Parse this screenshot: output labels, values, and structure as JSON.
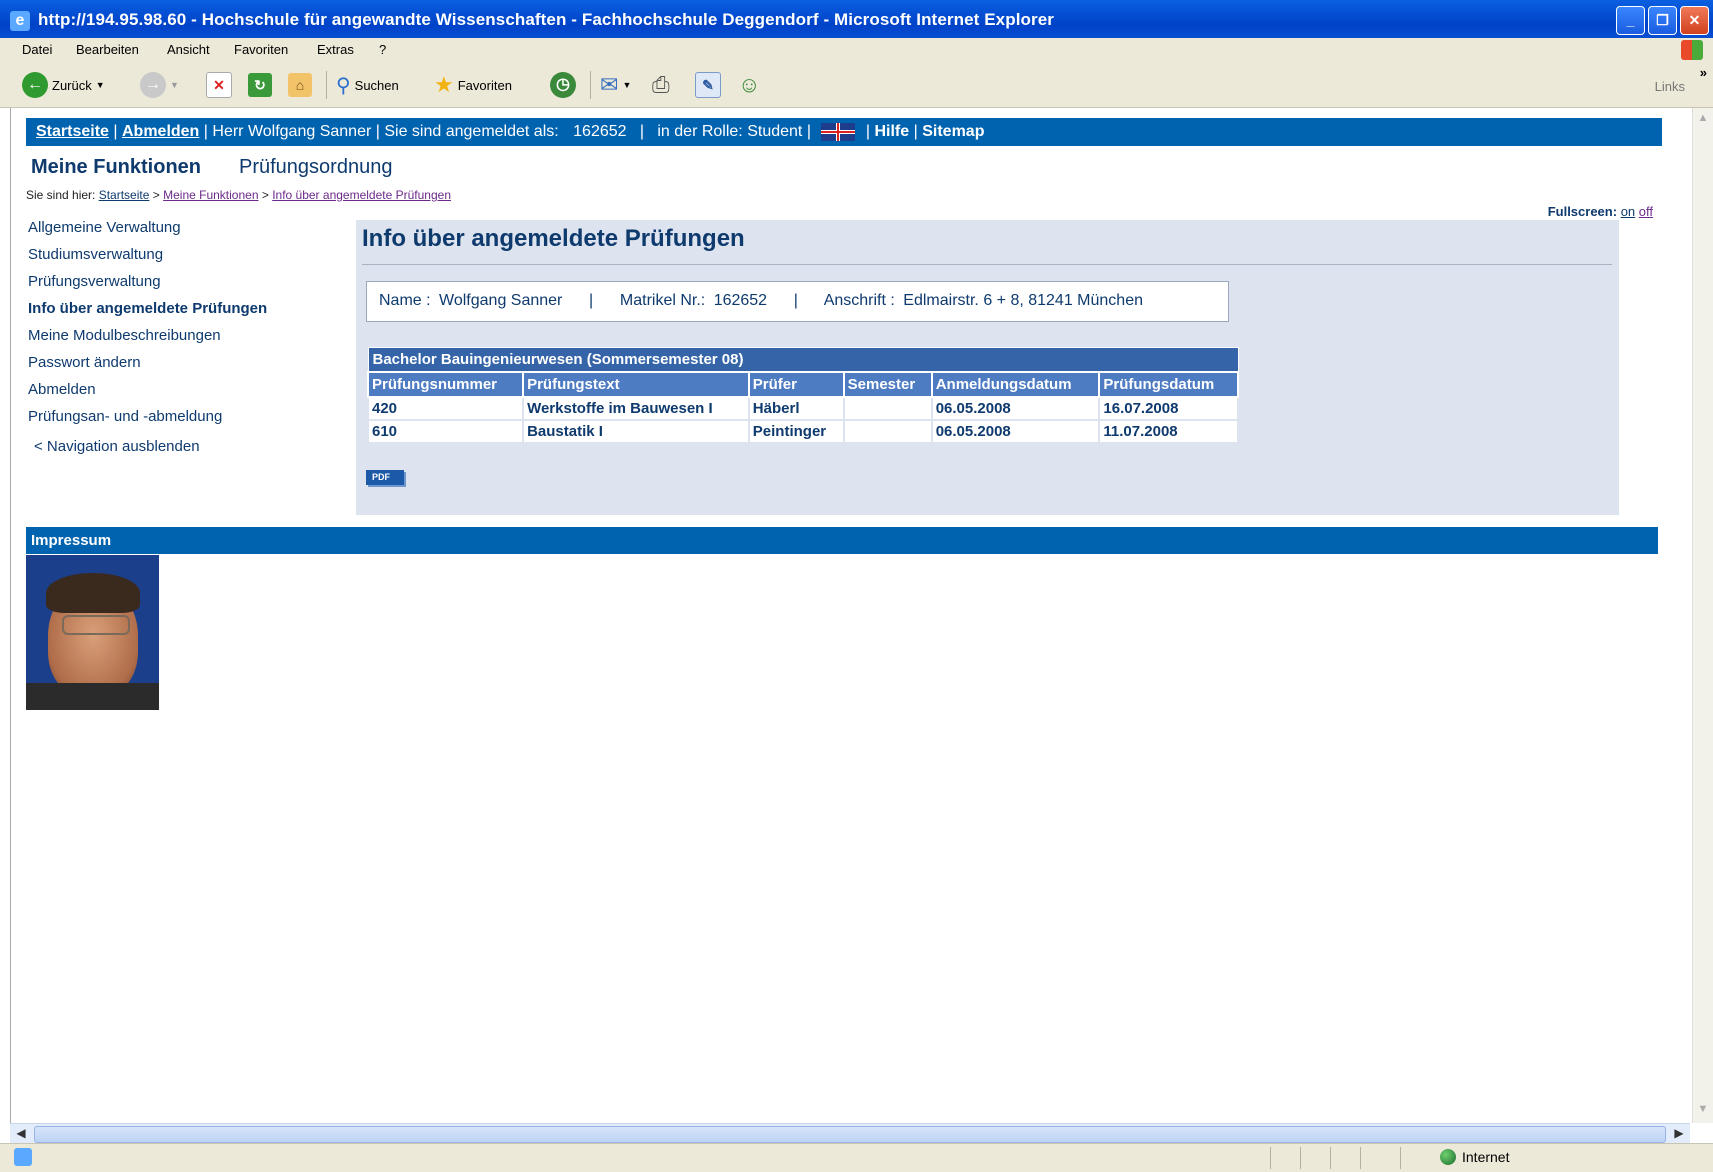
{
  "window": {
    "title": "http://194.95.98.60 - Hochschule für angewandte Wissenschaften - Fachhochschule Deggendorf - Microsoft Internet Explorer"
  },
  "menubar": [
    "Datei",
    "Bearbeiten",
    "Ansicht",
    "Favoriten",
    "Extras",
    "?"
  ],
  "toolbar": {
    "back": "Zurück",
    "search": "Suchen",
    "favorites": "Favoriten",
    "links": "Links"
  },
  "topnav": {
    "home": "Startseite",
    "logout": "Abmelden",
    "user": "Herr Wolfgang Sanner",
    "logged_in_as": "Sie sind angemeldet als:",
    "user_id": "162652",
    "role_label": "in der Rolle:",
    "role": "Student",
    "help": "Hilfe",
    "sitemap": "Sitemap"
  },
  "tabs": {
    "active": "Meine Funktionen",
    "other": "Prüfungsordnung"
  },
  "breadcrumb": {
    "prefix": "Sie sind hier:",
    "items": [
      "Startseite",
      "Meine Funktionen",
      "Info über angemeldete Prüfungen"
    ]
  },
  "fullscreen": {
    "label": "Fullscreen:",
    "on": "on",
    "off": "off"
  },
  "sidebar": {
    "items": [
      "Allgemeine Verwaltung",
      "Studiumsverwaltung",
      "Prüfungsverwaltung",
      "Info über angemeldete Prüfungen",
      "Meine Modulbeschreibungen",
      "Passwort ändern",
      "Abmelden",
      "Prüfungsan- und -abmeldung"
    ],
    "current_index": 3,
    "hide_nav": "< Navigation ausblenden"
  },
  "main": {
    "heading": "Info über angemeldete Prüfungen",
    "info": {
      "name_label": "Name :",
      "name": "Wolfgang Sanner",
      "matrikel_label": "Matrikel Nr.:",
      "matrikel": "162652",
      "address_label": "Anschrift :",
      "address": "Edlmairstr. 6 + 8, 81241 München"
    },
    "table": {
      "caption": "Bachelor Bauingenieurwesen (Sommersemester 08)",
      "headers": [
        "Prüfungsnummer",
        "Prüfungstext",
        "Prüfer",
        "Semester",
        "Anmeldungsdatum",
        "Prüfungsdatum"
      ],
      "rows": [
        [
          "420",
          "Werkstoffe im Bauwesen I",
          "Häberl",
          "",
          "06.05.2008",
          "16.07.2008"
        ],
        [
          "610",
          "Baustatik I",
          "Peintinger",
          "",
          "06.05.2008",
          "11.07.2008"
        ]
      ]
    },
    "pdf": "PDF"
  },
  "impressum": "Impressum",
  "status": {
    "zone": "Internet"
  },
  "colors": {
    "nav_blue": "#0063b0",
    "text_navy": "#0e3a6e",
    "content_bg": "#dde3ef"
  }
}
